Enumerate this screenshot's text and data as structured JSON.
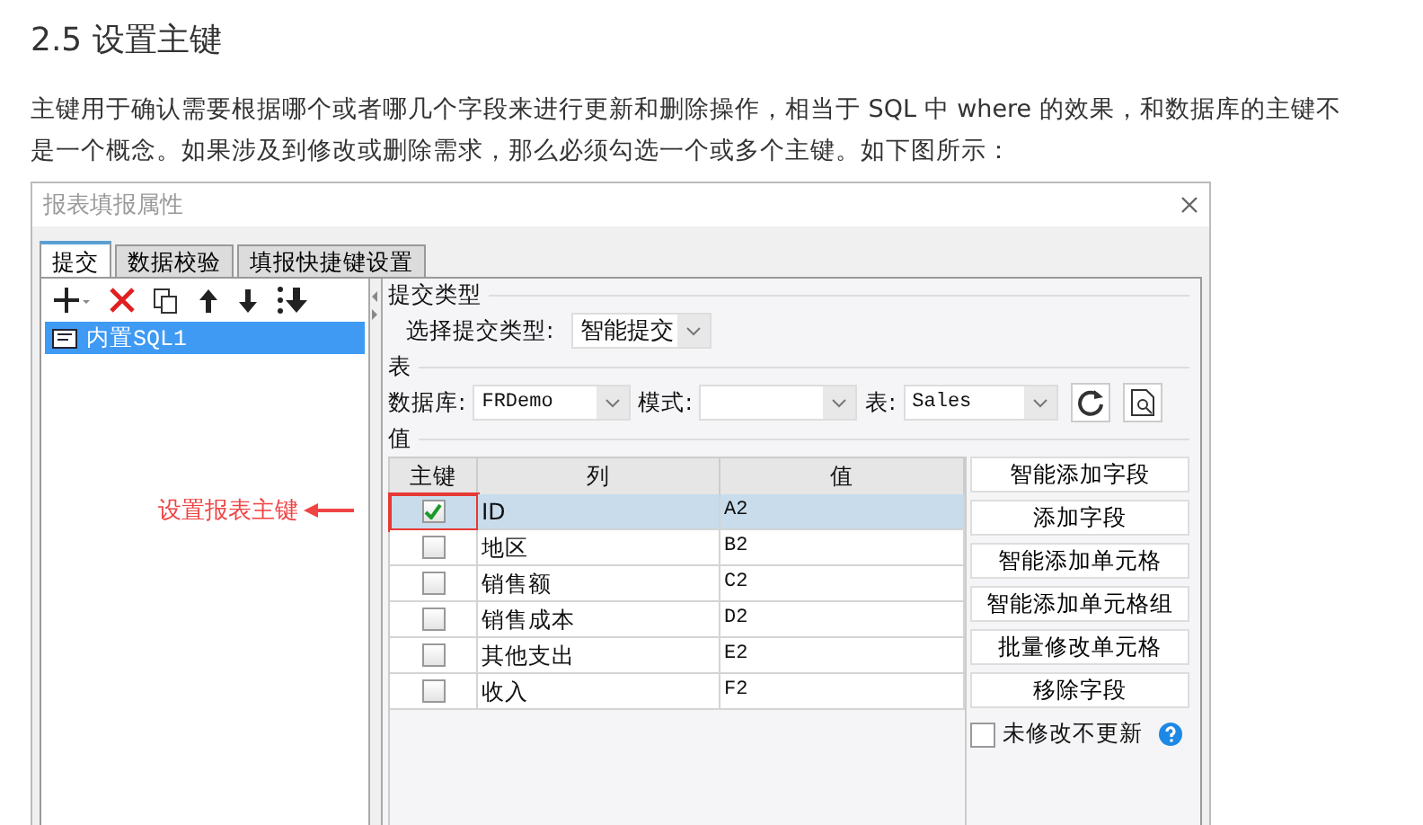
{
  "heading": "2.5 设置主键",
  "paragraph": "主键用于确认需要根据哪个或者哪几个字段来进行更新和删除操作，相当于 SQL 中 where 的效果，和数据库的主键不是一个概念。如果涉及到修改或删除需求，那么必须勾选一个或多个主键。如下图所示：",
  "dialog": {
    "title": "报表填报属性",
    "tabs": [
      {
        "label": "提交",
        "selected": true
      },
      {
        "label": "数据校验",
        "selected": false
      },
      {
        "label": "填报快捷键设置",
        "selected": false
      }
    ],
    "list_items": [
      {
        "label": "内置SQL1",
        "selected": true
      }
    ],
    "submit_type": {
      "group": "提交类型",
      "label": "选择提交类型:",
      "value": "智能提交"
    },
    "table_group": {
      "group": "表",
      "database_label": "数据库:",
      "database": "FRDemo",
      "schema_label": "模式:",
      "table_label": "表:",
      "table": "Sales"
    },
    "value_group": "值",
    "columns": [
      "主键",
      "列",
      "值"
    ],
    "rows": [
      {
        "checked": true,
        "selected": true,
        "highlighted": true,
        "column": "ID",
        "value": "A2"
      },
      {
        "checked": false,
        "selected": false,
        "highlighted": false,
        "column": "地区",
        "value": "B2"
      },
      {
        "checked": false,
        "selected": false,
        "highlighted": false,
        "column": "销售额",
        "value": "C2"
      },
      {
        "checked": false,
        "selected": false,
        "highlighted": false,
        "column": "销售成本",
        "value": "D2"
      },
      {
        "checked": false,
        "selected": false,
        "highlighted": false,
        "column": "其他支出",
        "value": "E2"
      },
      {
        "checked": false,
        "selected": false,
        "highlighted": false,
        "column": "收入",
        "value": "F2"
      }
    ],
    "buttons": [
      "智能添加字段",
      "添加字段",
      "智能添加单元格",
      "智能添加单元格组",
      "批量修改单元格",
      "移除字段"
    ],
    "no_update": {
      "label": "未修改不更新",
      "checked": false
    }
  },
  "callout": "设置报表主键"
}
